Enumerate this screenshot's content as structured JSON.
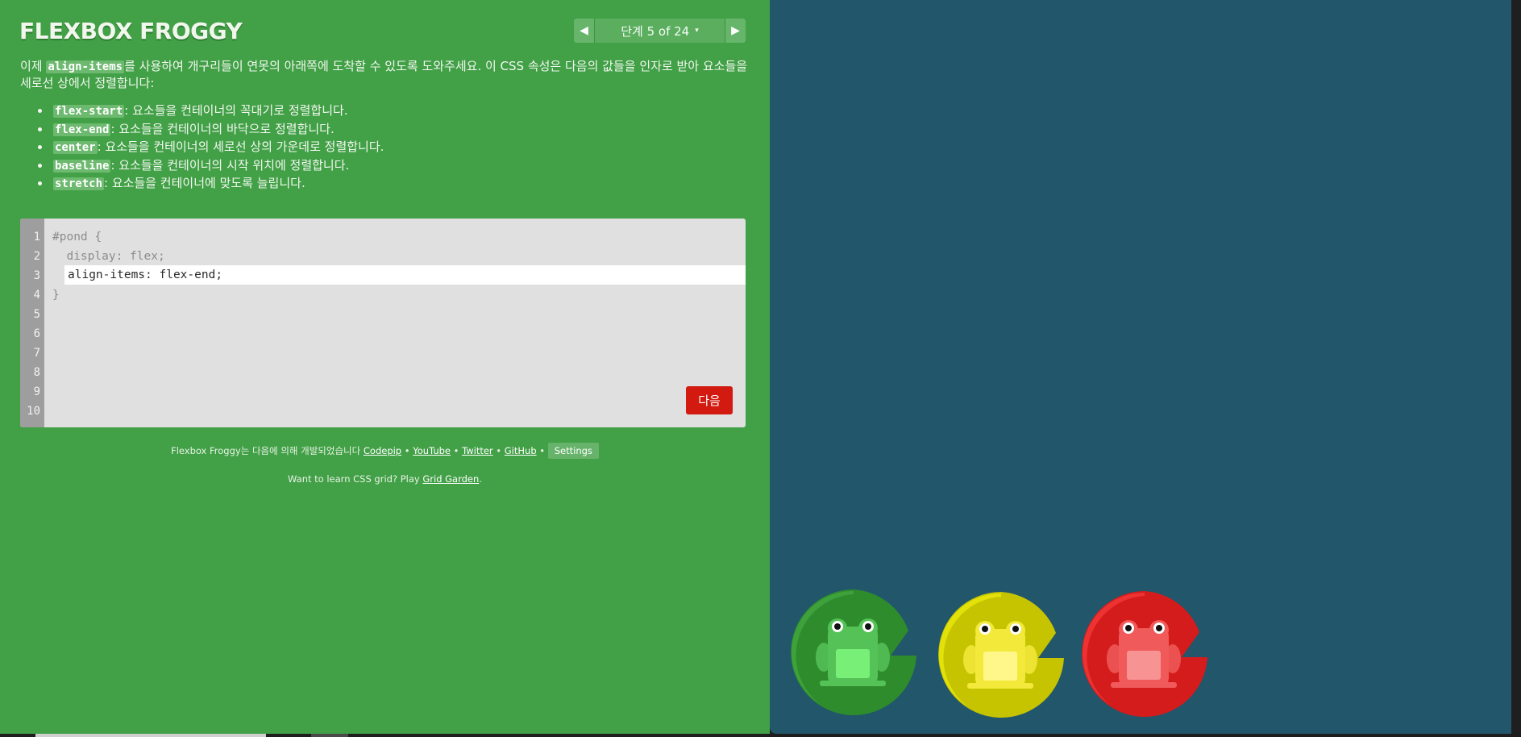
{
  "app": {
    "title": "FLEXBOX FROGGY"
  },
  "level_nav": {
    "prev_icon": "triangle-left-icon",
    "next_icon": "triangle-right-icon",
    "label": "단계 5 of 24",
    "caret": "▾"
  },
  "instructions": {
    "before": "이제 ",
    "property": "align-items",
    "after": "를 사용하여 개구리들이 연못의 아래쪽에 도착할 수 있도록 도와주세요. 이 CSS 속성은 다음의 값들을 인자로 받아 요소들을 세로선 상에서 정렬합니다:"
  },
  "values": [
    {
      "code": "flex-start",
      "desc": ": 요소들을 컨테이너의 꼭대기로 정렬합니다."
    },
    {
      "code": "flex-end",
      "desc": ": 요소들을 컨테이너의 바닥으로 정렬합니다."
    },
    {
      "code": "center",
      "desc": ": 요소들을 컨테이너의 세로선 상의 가운데로 정렬합니다."
    },
    {
      "code": "baseline",
      "desc": ": 요소들을 컨테이너의 시작 위치에 정렬합니다."
    },
    {
      "code": "stretch",
      "desc": ": 요소들을 컨테이너에 맞도록 늘립니다."
    }
  ],
  "editor": {
    "line_numbers": [
      "1",
      "2",
      "3",
      "4",
      "5",
      "6",
      "7",
      "8",
      "9",
      "10"
    ],
    "line1": "#pond {",
    "line2": "  display: flex;",
    "input_value": "align-items: flex-end;",
    "line4": "}",
    "next_label": "다음"
  },
  "footer": {
    "credits_prefix": "Flexbox Froggy는 다음에 의해 개발되었습니다 ",
    "links": [
      "Codepip",
      "YouTube",
      "Twitter",
      "GitHub"
    ],
    "separator": " • ",
    "settings_label": "Settings",
    "grid_prefix": "Want to learn CSS grid? Play ",
    "grid_link": "Grid Garden",
    "grid_suffix": "."
  },
  "pond": {
    "frogs": [
      {
        "name": "green",
        "pad_color": "#2e8c2c",
        "pad_light": "#3fa13b",
        "frog_color": "#55c258",
        "belly": "#78f078"
      },
      {
        "name": "yellow",
        "pad_color": "#c6c400",
        "pad_light": "#e3e10a",
        "frog_color": "#f2e93b",
        "belly": "#fff78a"
      },
      {
        "name": "red",
        "pad_color": "#d41c1c",
        "pad_light": "#ee3131",
        "frog_color": "#f05a5a",
        "belly": "#f79393"
      }
    ]
  },
  "colors": {
    "sidebar_bg": "#42a047",
    "pond_bg": "#21566b",
    "next_button": "#d21a10"
  }
}
